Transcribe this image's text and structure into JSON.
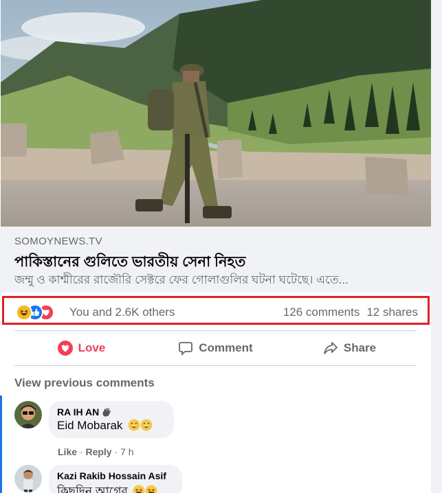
{
  "post": {
    "domain": "SOMOYNEWS.TV",
    "headline": "পাকিস্তানের গুলিতে ভারতীয় সেনা নিহত",
    "description": "জম্মু ও কাশ্মীরের রাজৌরি সেক্টরে ফের গোলাগুলির ঘটনা ঘটেছে। এতে...",
    "reactions_text": "You and 2.6K others",
    "comments_count": "126 comments",
    "shares_count": "12 shares",
    "reaction_icons": [
      "haha-icon",
      "like-icon",
      "love-icon"
    ]
  },
  "actions": {
    "love_label": "Love",
    "comment_label": "Comment",
    "share_label": "Share"
  },
  "comments": {
    "view_previous": "View previous comments",
    "items": [
      {
        "author": "RA IH AN",
        "text": "Eid Mobarak",
        "like_label": "Like",
        "reply_label": "Reply",
        "time": "7 h"
      },
      {
        "author": "Kazi Rakib Hossain Asif",
        "text": "কিছুদিন আগের"
      }
    ]
  },
  "colors": {
    "accent_love": "#f33e58",
    "link_blue": "#1b74e4",
    "highlight_red": "#e0211e"
  }
}
